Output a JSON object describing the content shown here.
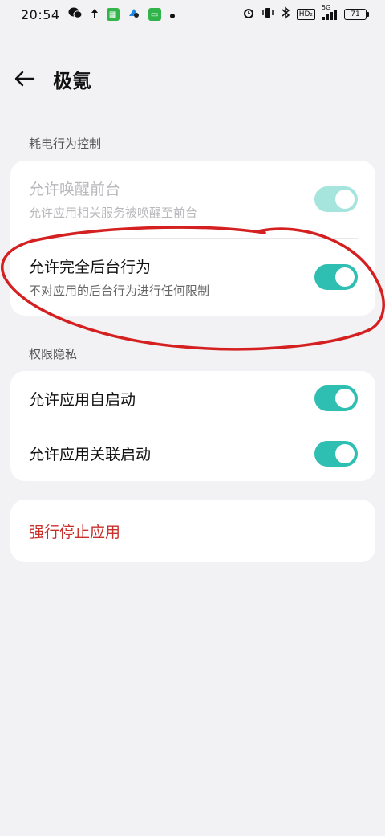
{
  "status_bar": {
    "time": "20:54",
    "network_badge": "HD₂",
    "signal_badge": "5G",
    "battery": "71",
    "icons": [
      "wechat-icon",
      "upload-arrow-icon",
      "app-store-icon",
      "map-app-icon",
      "messages-app-icon",
      "dot-icon",
      "alarm-icon",
      "vibrate-icon",
      "bluetooth-icon",
      "signal-icon"
    ]
  },
  "header": {
    "title": "极氪",
    "back_icon": "back-arrow-icon"
  },
  "sections": {
    "power": {
      "label": "耗电行为控制",
      "items": [
        {
          "title": "允许唤醒前台",
          "subtitle": "允许应用相关服务被唤醒至前台",
          "enabled": false,
          "on": true
        },
        {
          "title": "允许完全后台行为",
          "subtitle": "不对应用的后台行为进行任何限制",
          "enabled": true,
          "on": true
        }
      ]
    },
    "privacy": {
      "label": "权限隐私",
      "items": [
        {
          "title": "允许应用自启动",
          "on": true
        },
        {
          "title": "允许应用关联启动",
          "on": true
        }
      ]
    },
    "actions": {
      "force_stop": "强行停止应用"
    }
  },
  "colors": {
    "accent": "#2fbfb2",
    "accent_disabled": "#a6e4de",
    "danger": "#c9302c",
    "annotation": "#d42020",
    "background": "#f2f2f4"
  }
}
